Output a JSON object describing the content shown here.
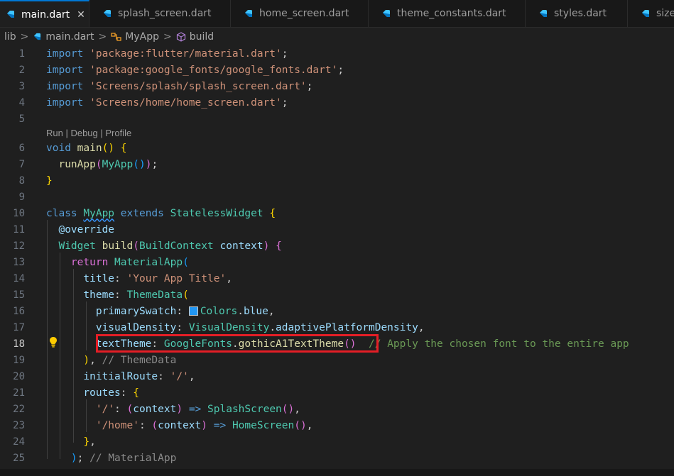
{
  "tabs": [
    {
      "label": "main.dart",
      "close": "✕"
    },
    {
      "label": "splash_screen.dart"
    },
    {
      "label": "home_screen.dart"
    },
    {
      "label": "theme_constants.dart"
    },
    {
      "label": "styles.dart"
    },
    {
      "label": "size"
    }
  ],
  "breadcrumb": {
    "items": [
      "lib",
      "main.dart",
      "MyApp",
      "build"
    ],
    "separator": ">"
  },
  "codelens": "Run | Debug | Profile",
  "line_numbers": [
    "1",
    "2",
    "3",
    "4",
    "5",
    "6",
    "7",
    "8",
    "9",
    "10",
    "11",
    "12",
    "13",
    "14",
    "15",
    "16",
    "17",
    "18",
    "19",
    "20",
    "21",
    "22",
    "23",
    "24",
    "25"
  ],
  "code": {
    "l1": {
      "kw": "import",
      "str": "'package:flutter/material.dart'",
      "p": ";"
    },
    "l2": {
      "kw": "import",
      "str": "'package:google_fonts/google_fonts.dart'",
      "p": ";"
    },
    "l3": {
      "kw": "import",
      "str": "'Screens/splash/splash_screen.dart'",
      "p": ";"
    },
    "l4": {
      "kw": "import",
      "str": "'Screens/home/home_screen.dart'",
      "p": ";"
    },
    "l6": {
      "kw": "void",
      "fn": "main",
      "a": "(",
      "b": ")",
      "c": " {"
    },
    "l7": {
      "fn": "runApp",
      "a": "(",
      "cls": "MyApp",
      "b": "()",
      "c": ")",
      "d": ";"
    },
    "l8": {
      "c": "}"
    },
    "l10": {
      "kw1": "class",
      "cls1": "MyApp",
      "kw2": "extends",
      "cls2": "StatelessWidget",
      "c": "{"
    },
    "l11": {
      "t": "@override"
    },
    "l12": {
      "cls1": "Widget",
      "fn": "build",
      "a": "(",
      "cls2": "BuildContext",
      "var": "context",
      "b": ")",
      "c": "{"
    },
    "l13": {
      "kw": "return",
      "cls": "MaterialApp",
      "a": "("
    },
    "l14": {
      "var": "title",
      "p": ":",
      "str": "'Your App Title'",
      "q": ","
    },
    "l15": {
      "var": "theme",
      "p": ":",
      "cls": "ThemeData",
      "a": "("
    },
    "l16": {
      "var": "primarySwatch",
      "p": ":",
      "cls": "Colors",
      "q": ".",
      "v2": "blue",
      "r": ","
    },
    "l17": {
      "var": "visualDensity",
      "p": ":",
      "cls": "VisualDensity",
      "q": ".",
      "v2": "adaptivePlatformDensity",
      "r": ","
    },
    "l18": {
      "var": "textTheme",
      "p": ":",
      "cls": "GoogleFonts",
      "q": ".",
      "fn": "gothicA1TextTheme",
      "a": "()",
      "cmt": "// Apply the chosen font to the entire app"
    },
    "l19": {
      "a": ")",
      "q": ",",
      "ghost": "// ThemeData"
    },
    "l20": {
      "var": "initialRoute",
      "p": ":",
      "str": "'/'",
      "q": ","
    },
    "l21": {
      "var": "routes",
      "p": ":",
      "a": "{"
    },
    "l22": {
      "str": "'/'",
      "p": ":",
      "a": "(",
      "var": "context",
      "b": ")",
      "arr": "=>",
      "cls": "SplashScreen",
      "c": "()",
      "q": ","
    },
    "l23": {
      "str": "'/home'",
      "p": ":",
      "a": "(",
      "var": "context",
      "b": ")",
      "arr": "=>",
      "cls": "HomeScreen",
      "c": "()",
      "q": ","
    },
    "l24": {
      "a": "}",
      "q": ","
    },
    "l25": {
      "a": ")",
      "q": ";",
      "ghost": "// MaterialApp"
    }
  },
  "colors": {
    "highlight_box": "#e41e26",
    "swatch_blue": "#2196f3",
    "active_tab_border": "#0078d4"
  }
}
